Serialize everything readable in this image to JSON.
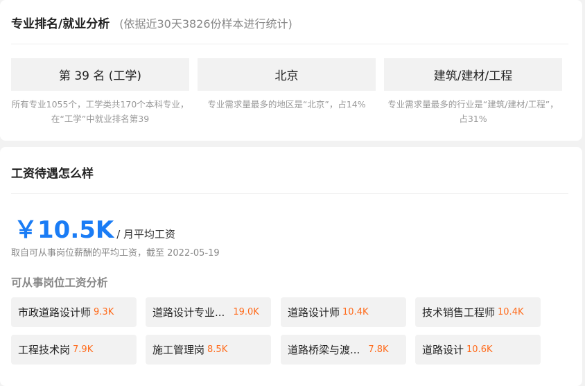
{
  "ranking": {
    "title": "专业排名/就业分析",
    "subtitle": "(依据近30天3826份样本进行统计)",
    "stats": [
      {
        "value": "第 39 名 (工学)",
        "desc": "所有专业1055个，工学类共170个本科专业，在“工学”中就业排名第39"
      },
      {
        "value": "北京",
        "desc": "专业需求量最多的地区是“北京”，占14%"
      },
      {
        "value": "建筑/建材/工程",
        "desc": "专业需求量最多的行业是“建筑/建材/工程”，占31%"
      }
    ]
  },
  "salary": {
    "title": "工资待遇怎么样",
    "value": "￥10.5K",
    "unit": "/ 月平均工资",
    "note": "取自可从事岗位薪酬的平均工资，截至 2022-05-19",
    "section_title": "可从事岗位工资分析",
    "jobs": [
      {
        "name": "市政道路设计师",
        "salary": "9.3K"
      },
      {
        "name": "道路设计专业...",
        "salary": "19.0K"
      },
      {
        "name": "道路设计师",
        "salary": "10.4K"
      },
      {
        "name": "技术销售工程师",
        "salary": "10.4K"
      },
      {
        "name": "工程技术岗",
        "salary": "7.9K"
      },
      {
        "name": "施工管理岗",
        "salary": "8.5K"
      },
      {
        "name": "道路桥梁与渡...",
        "salary": "7.8K"
      },
      {
        "name": "道路设计",
        "salary": "10.6K"
      }
    ]
  }
}
